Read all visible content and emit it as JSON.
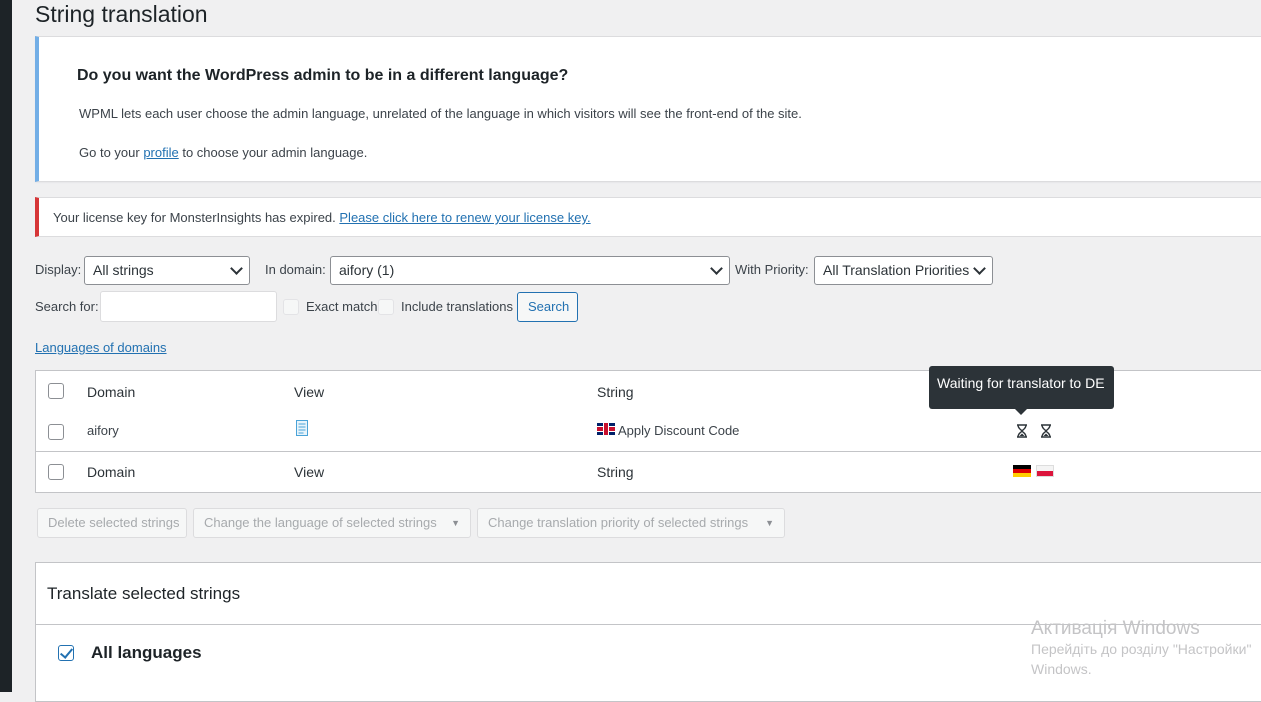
{
  "page": {
    "title": "String translation"
  },
  "admin_language_notice": {
    "heading": "Do you want the WordPress admin to be in a different language?",
    "text1": "WPML lets each user choose the admin language, unrelated of the language in which visitors will see the front-end of the site.",
    "text2_before": "Go to your ",
    "text2_link": "profile",
    "text2_after": " to choose your admin language.",
    "accent_color": "#72aee6"
  },
  "license_notice": {
    "text": "Your license key for MonsterInsights has expired. ",
    "link": "Please click here to renew your license key.",
    "accent_color": "#d63638"
  },
  "filters": {
    "display_label": "Display:",
    "display_value": "All strings",
    "domain_label": "In domain:",
    "domain_value": "aifory (1)",
    "priority_label": "With Priority:",
    "priority_value": "All Translation Priorities",
    "search_label": "Search for:",
    "search_value": "",
    "exact_match_label": "Exact match",
    "include_translations_label": "Include translations",
    "search_button": "Search",
    "languages_of_domains_link": "Languages of domains"
  },
  "table": {
    "columns": [
      "Domain",
      "View",
      "String"
    ],
    "rows": [
      {
        "domain": "aifory",
        "view_icon": "document-icon",
        "string_flag": "flag-gb",
        "string": "Apply Discount Code",
        "status_icons": [
          "hourglass-icon",
          "hourglass-icon"
        ]
      }
    ],
    "language_flags": [
      "flag-de",
      "flag-pl"
    ]
  },
  "tooltip": {
    "text": "Waiting for translator to DE"
  },
  "bulk_actions": {
    "delete": "Delete selected strings",
    "change_language": "Change the language of selected strings",
    "change_priority": "Change translation priority of selected strings"
  },
  "translate_section": {
    "title": "Translate selected strings",
    "all_languages_label": "All languages",
    "all_languages_checked": true
  },
  "watermark": {
    "line1": "Активація Windows",
    "line2": "Перейдіть до розділу \"Настройки\"",
    "line3": "Windows."
  }
}
